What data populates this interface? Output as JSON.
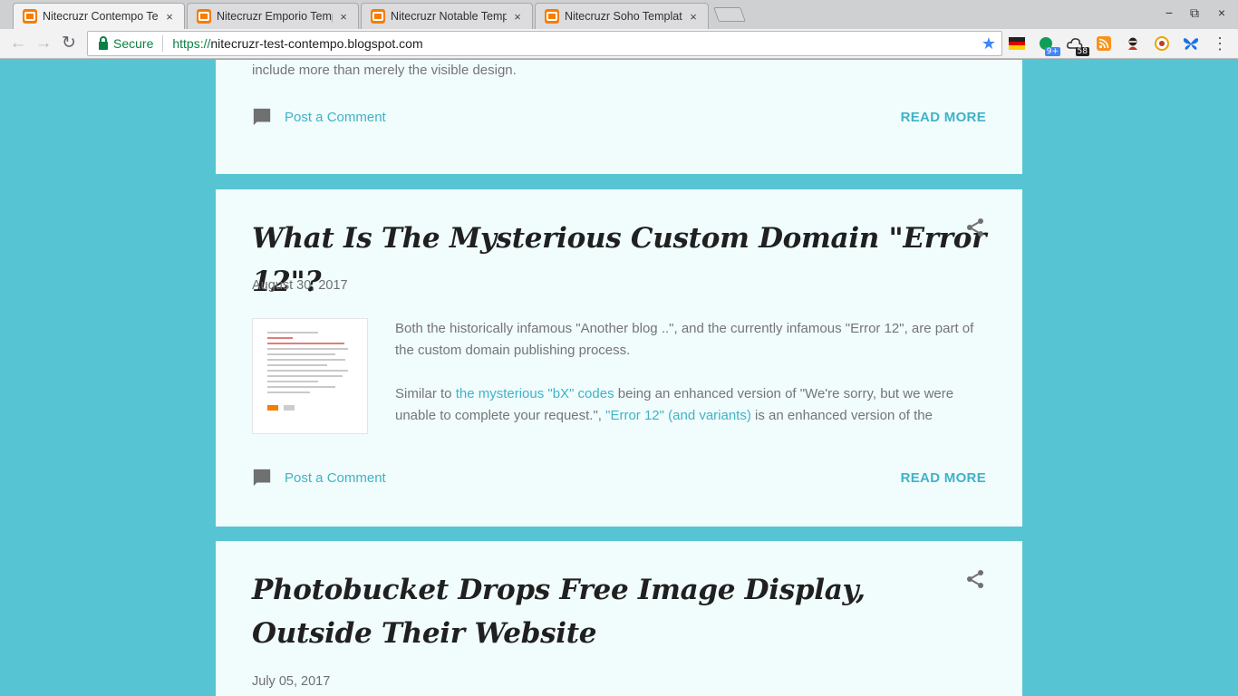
{
  "browser": {
    "tabs": [
      {
        "title": "Nitecruzr Contempo Templ",
        "close": "×"
      },
      {
        "title": "Nitecruzr Emporio Templ",
        "close": "×"
      },
      {
        "title": "Nitecruzr Notable Templ",
        "close": "×"
      },
      {
        "title": "Nitecruzr Soho Template",
        "close": "×"
      }
    ],
    "window_controls": {
      "minimize": "−",
      "restore": "⧉",
      "close": "×"
    },
    "nav": {
      "back": "←",
      "forward": "→",
      "reload": "↻"
    },
    "address": {
      "secure_label": "Secure",
      "scheme": "https://",
      "host": "nitecruzr-test-contempo.blogspot.com",
      "star": "★"
    },
    "extensions": [
      {
        "name": "germany-flag-icon"
      },
      {
        "name": "hangouts-icon",
        "badge": "9+",
        "badge_color": "#4285f4"
      },
      {
        "name": "cloud-icon",
        "badge": "58",
        "badge_color": "#222222"
      },
      {
        "name": "rss-icon"
      },
      {
        "name": "ninja-icon"
      },
      {
        "name": "circle-logo-icon"
      },
      {
        "name": "butterfly-icon"
      },
      {
        "name": "menu-icon",
        "glyph": "⋮"
      }
    ]
  },
  "posts": [
    {
      "snippet_tail": "include more than merely the visible design.",
      "comment_label": "Post a Comment",
      "read_more": "READ MORE"
    },
    {
      "title": "What Is The Mysterious Custom Domain \"Error 12\"?",
      "date": "August 30, 2017",
      "para1": "Both the historically infamous \"Another blog ..\", and the currently infamous \"Error 12\", are part of the custom domain publishing process.",
      "para2_start": "Similar to ",
      "para2_link1": "the mysterious \"bX\" codes",
      "para2_mid": " being an enhanced version of \"We're sorry, but we were unable to complete your request.\", ",
      "para2_link2": "\"Error 12\" (and variants)",
      "para2_end": " is an enhanced version of the",
      "comment_label": "Post a Comment",
      "read_more": "READ MORE"
    },
    {
      "title": "Photobucket Drops Free Image Display, Outside Their Website",
      "date": "July 05, 2017"
    }
  ],
  "colors": {
    "page_bg": "#57c4d3",
    "card_bg": "#f1fcfd",
    "link": "#3fb3c6",
    "tab_favicon": "#f57d00"
  }
}
